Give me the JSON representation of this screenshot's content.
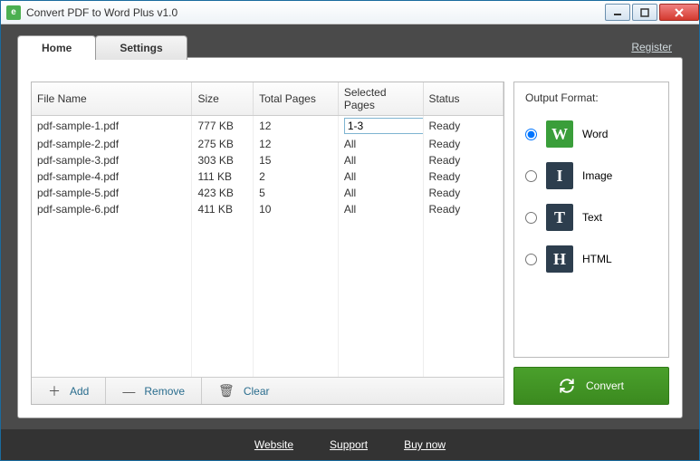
{
  "window": {
    "title": "Convert PDF to Word Plus v1.0"
  },
  "tabs": {
    "home": "Home",
    "settings": "Settings"
  },
  "register_link": "Register",
  "table": {
    "headers": {
      "filename": "File Name",
      "size": "Size",
      "pages": "Total Pages",
      "selected": "Selected Pages",
      "status": "Status"
    },
    "rows": [
      {
        "filename": "pdf-sample-1.pdf",
        "size": "777 KB",
        "pages": "12",
        "selected": "1-3",
        "status": "Ready",
        "editable": true
      },
      {
        "filename": "pdf-sample-2.pdf",
        "size": "275 KB",
        "pages": "12",
        "selected": "All",
        "status": "Ready"
      },
      {
        "filename": "pdf-sample-3.pdf",
        "size": "303 KB",
        "pages": "15",
        "selected": "All",
        "status": "Ready"
      },
      {
        "filename": "pdf-sample-4.pdf",
        "size": "111 KB",
        "pages": "2",
        "selected": "All",
        "status": "Ready"
      },
      {
        "filename": "pdf-sample-5.pdf",
        "size": "423 KB",
        "pages": "5",
        "selected": "All",
        "status": "Ready"
      },
      {
        "filename": "pdf-sample-6.pdf",
        "size": "411 KB",
        "pages": "10",
        "selected": "All",
        "status": "Ready"
      }
    ]
  },
  "actions": {
    "add": "Add",
    "remove": "Remove",
    "clear": "Clear"
  },
  "output": {
    "title": "Output Format:",
    "options": [
      {
        "key": "word",
        "label": "Word",
        "glyph": "W",
        "selected": true
      },
      {
        "key": "image",
        "label": "Image",
        "glyph": "I"
      },
      {
        "key": "text",
        "label": "Text",
        "glyph": "T"
      },
      {
        "key": "html",
        "label": "HTML",
        "glyph": "H"
      }
    ]
  },
  "convert_label": "Convert",
  "footer": {
    "website": "Website",
    "support": "Support",
    "buy": "Buy now"
  }
}
